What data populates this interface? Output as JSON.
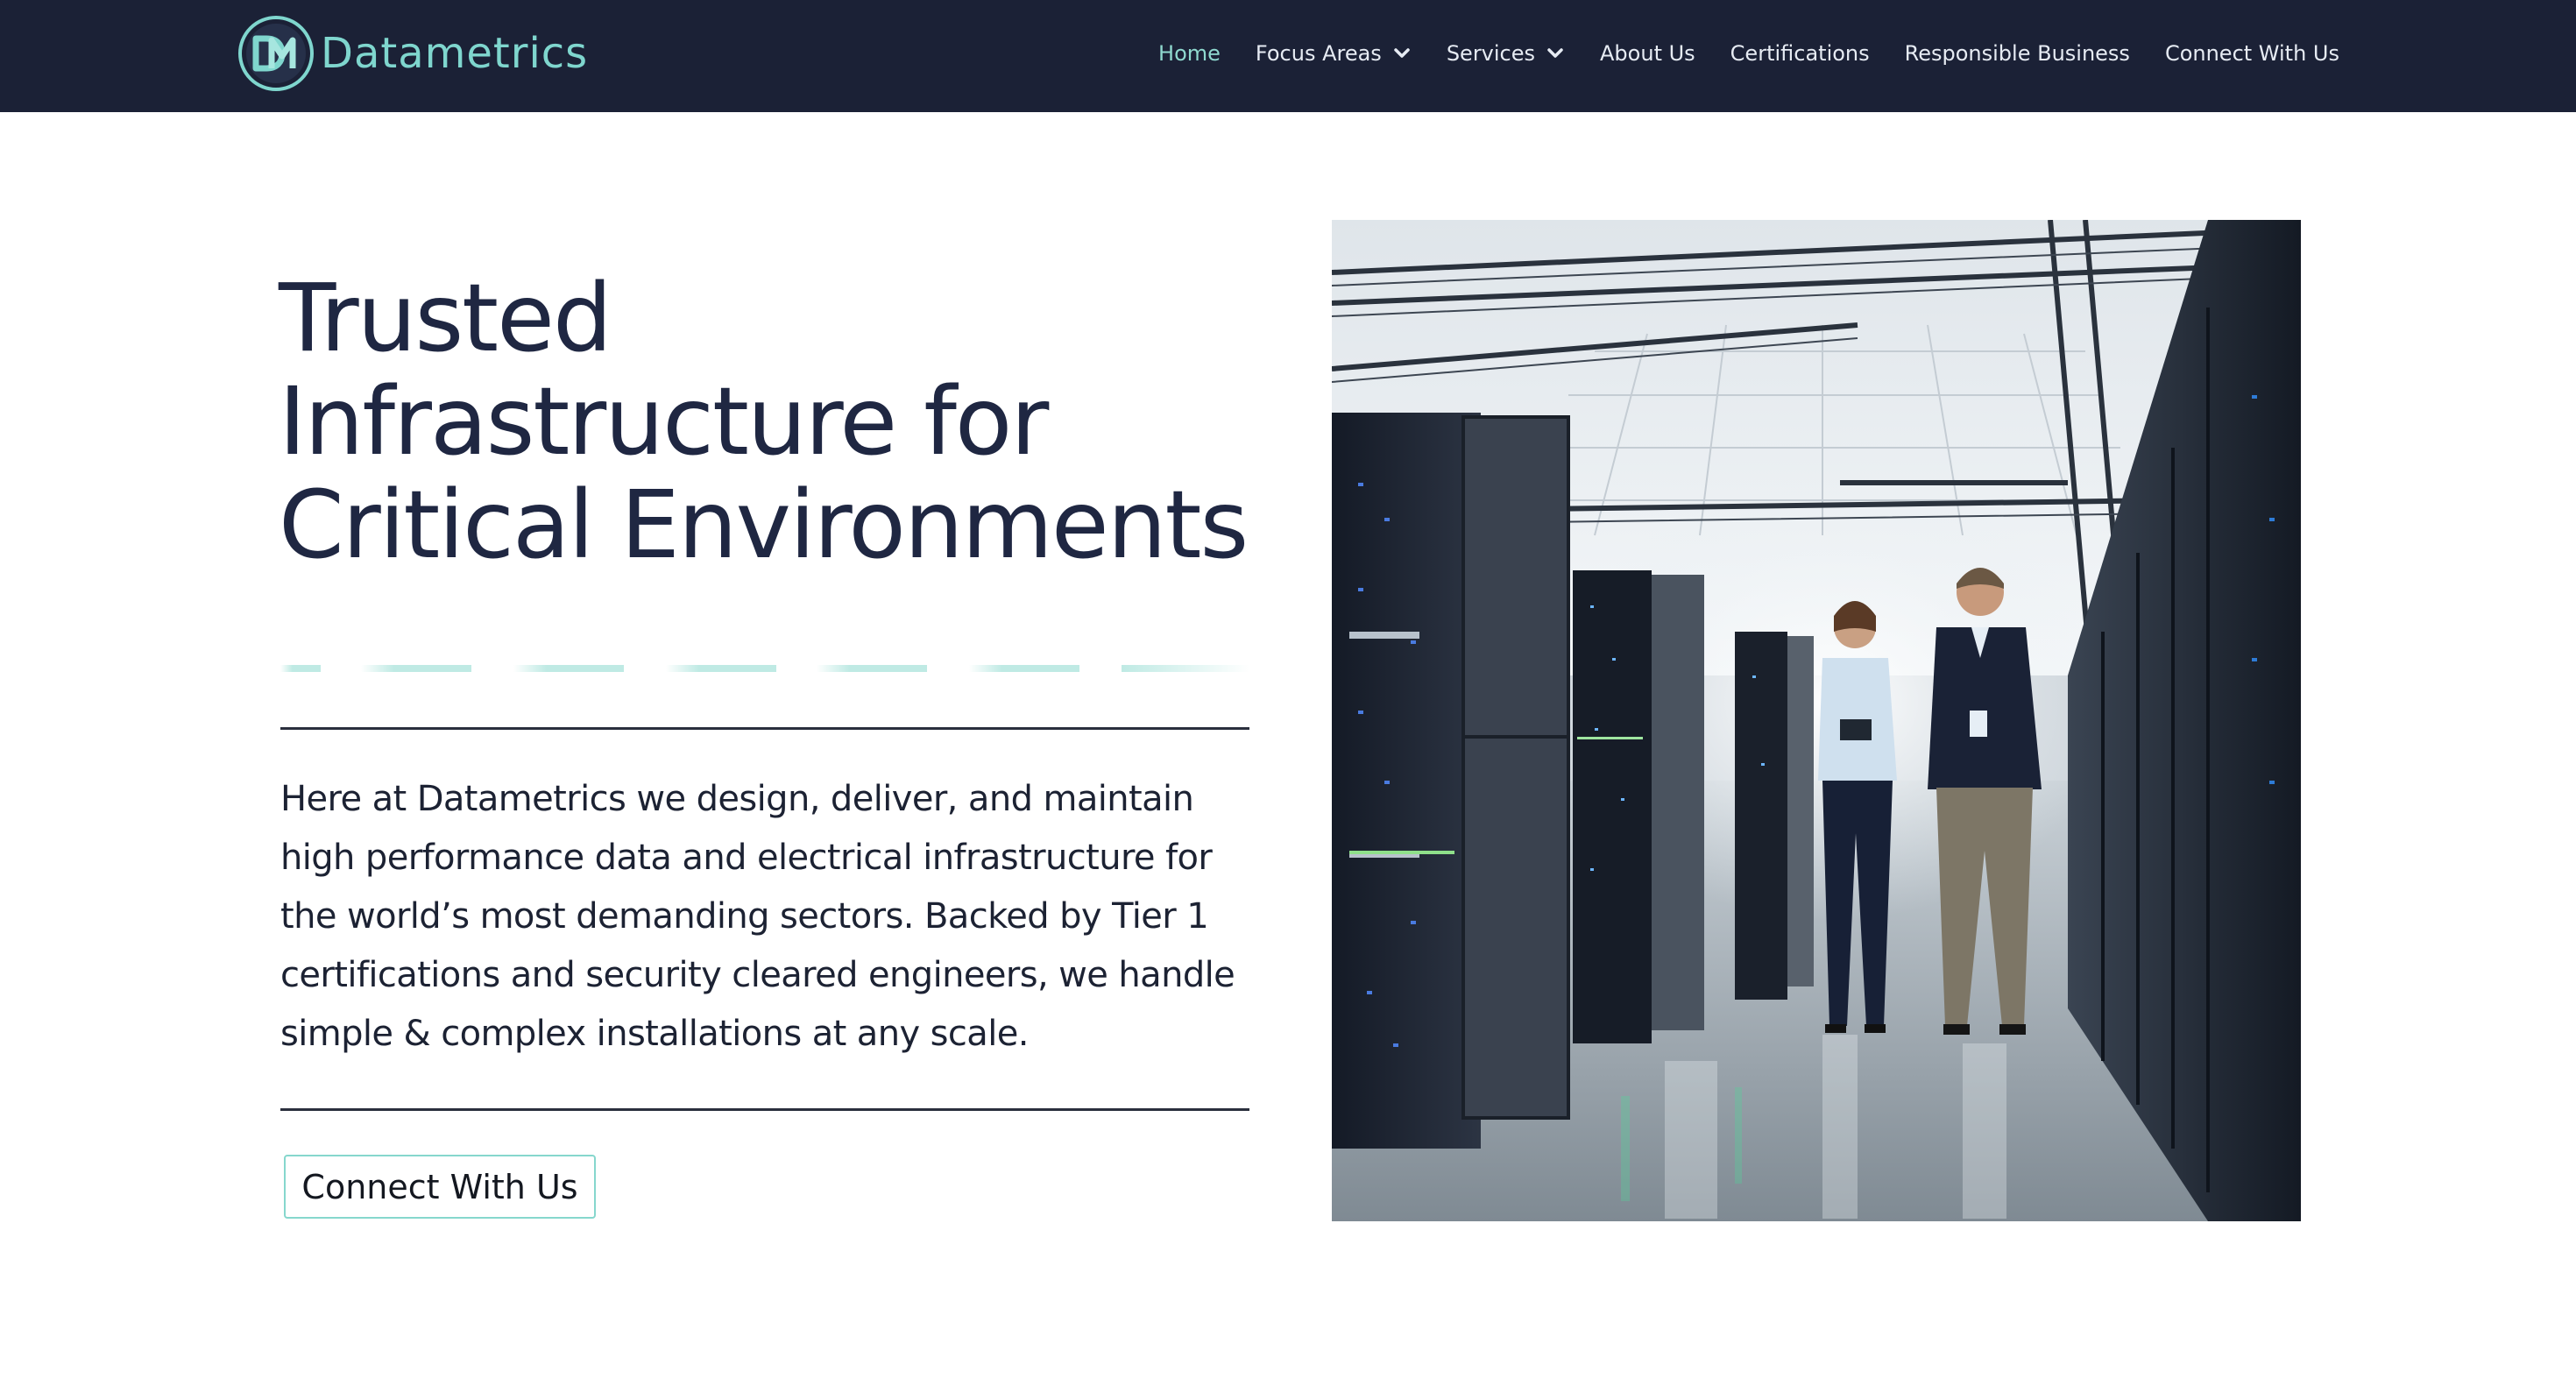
{
  "brand": {
    "name": "Datametrics",
    "accent_color": "#7fd6ce",
    "header_bg": "#1b2136",
    "text_color": "#1f2742"
  },
  "nav": {
    "items": [
      {
        "label": "Home",
        "active": true,
        "has_dropdown": false
      },
      {
        "label": "Focus Areas",
        "active": false,
        "has_dropdown": true
      },
      {
        "label": "Services",
        "active": false,
        "has_dropdown": true
      },
      {
        "label": "About Us",
        "active": false,
        "has_dropdown": false
      },
      {
        "label": "Certifications",
        "active": false,
        "has_dropdown": false
      },
      {
        "label": "Responsible Business",
        "active": false,
        "has_dropdown": false
      },
      {
        "label": "Connect With Us",
        "active": false,
        "has_dropdown": false
      }
    ]
  },
  "hero": {
    "title_lines": [
      "Trusted",
      "Infrastructure for",
      "Critical Environments"
    ],
    "body": "Here at Datametrics we design, deliver, and maintain high performance data and electrical infrastructure for the world’s most demanding sectors. Backed by Tier 1 certifications and security cleared engineers, we handle simple & complex installations at any scale.",
    "cta_label": "Connect With Us"
  },
  "icons": {
    "logo": "dm-monogram-logo-icon",
    "dropdown": "chevron-down-icon"
  }
}
